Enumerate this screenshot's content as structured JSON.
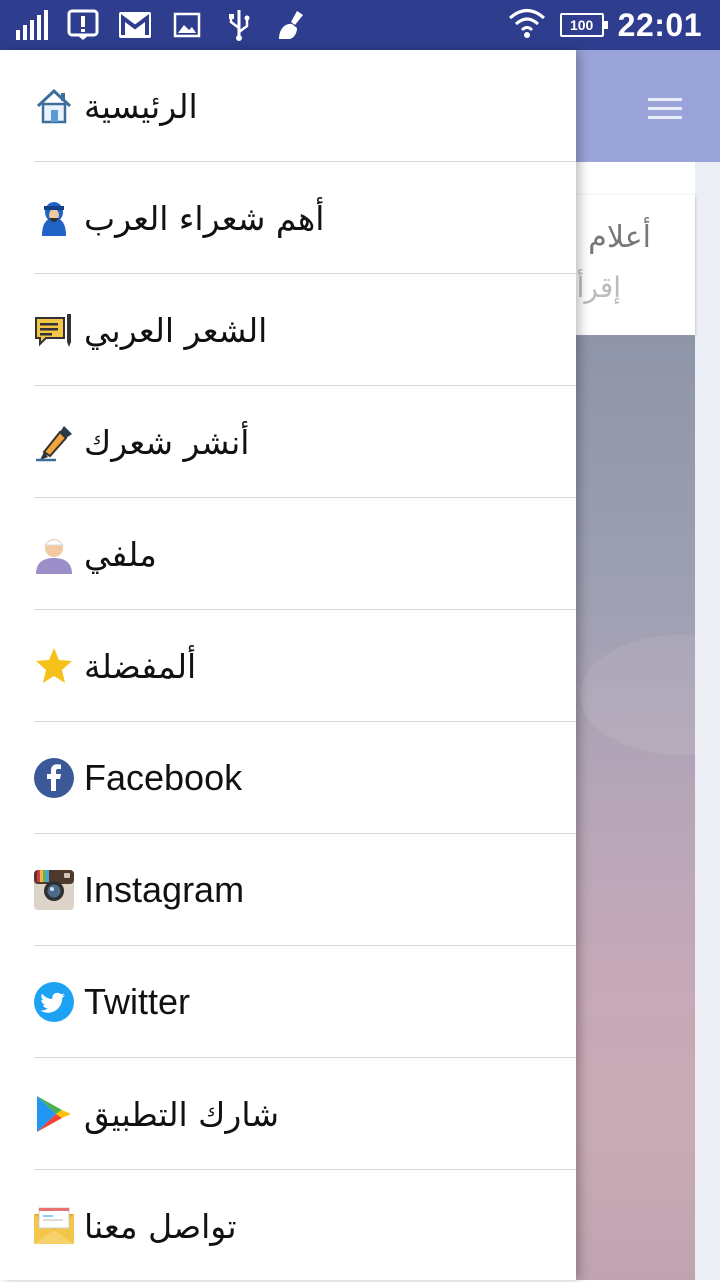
{
  "status_bar": {
    "time": "22:01",
    "battery": "100",
    "icons": [
      "signal-bars-icon",
      "alert-icon",
      "gmail-icon",
      "image-icon",
      "usb-icon",
      "cleaner-icon",
      "wifi-icon",
      "battery-icon"
    ]
  },
  "background": {
    "card_title": "أعلام",
    "card_subtitle": "إقرأ"
  },
  "drawer": {
    "items": [
      {
        "label": "الرئيسية",
        "icon": "home-icon"
      },
      {
        "label": "أهم شعراء العرب",
        "icon": "arab-poet-icon"
      },
      {
        "label": "الشعر العربي",
        "icon": "notes-pencil-icon"
      },
      {
        "label": "أنشر شعرك",
        "icon": "fountain-pen-icon"
      },
      {
        "label": "ملفي",
        "icon": "profile-icon"
      },
      {
        "label": "ألمفضلة",
        "icon": "star-icon"
      },
      {
        "label": "Facebook",
        "icon": "facebook-icon"
      },
      {
        "label": "Instagram",
        "icon": "instagram-icon"
      },
      {
        "label": "Twitter",
        "icon": "twitter-icon"
      },
      {
        "label": "شارك التطبيق",
        "icon": "play-store-icon"
      },
      {
        "label": "تواصل معنا",
        "icon": "envelope-icon"
      }
    ]
  },
  "colors": {
    "status_bar": "#2f3d8f",
    "toolbar": "#9aa4d8",
    "divider": "#d6d6d6",
    "star": "#f6c11b",
    "facebook": "#3b5998",
    "twitter": "#1da1f2"
  }
}
